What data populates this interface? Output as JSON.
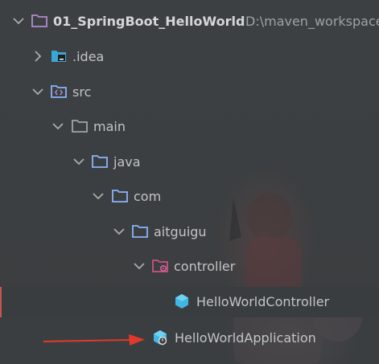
{
  "project_tree": {
    "root": {
      "label": "01_SpringBoot_HelloWorld",
      "path": "D:\\maven_workspace",
      "expanded": true,
      "icon": "folder-icon"
    },
    "items": [
      {
        "label": ".idea",
        "expanded": false,
        "icon": "idea-folder-icon"
      },
      {
        "label": "src",
        "expanded": true,
        "icon": "source-folder-icon"
      },
      {
        "label": "main",
        "expanded": true,
        "icon": "folder-icon"
      },
      {
        "label": "java",
        "expanded": true,
        "icon": "folder-icon"
      },
      {
        "label": "com",
        "expanded": true,
        "icon": "package-folder-icon"
      },
      {
        "label": "aitguigu",
        "expanded": true,
        "icon": "package-folder-icon"
      },
      {
        "label": "controller",
        "expanded": true,
        "icon": "controller-package-icon"
      },
      {
        "label": "HelloWorldController",
        "icon": "java-class-icon"
      },
      {
        "label": "HelloWorldApplication",
        "icon": "spring-boot-app-class-icon"
      }
    ]
  },
  "annotation": {
    "arrow_color": "#e0382c",
    "icon": "red-arrow-icon"
  },
  "colors": {
    "background": "#3c3f41",
    "text": "#c2c4c6",
    "folder": "#9aa7b0",
    "package_folder": "#8ab4f8",
    "class_icon": "#40b6e0",
    "selected_marker": "#c75450"
  }
}
